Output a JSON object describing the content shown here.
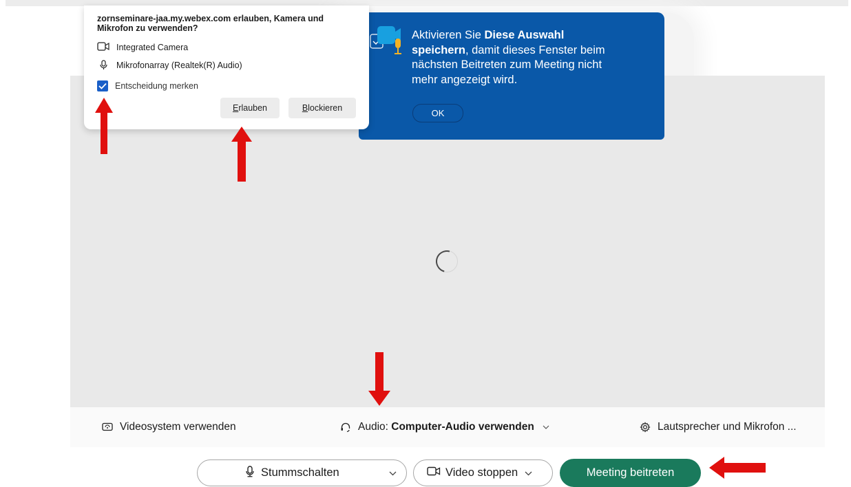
{
  "permission_dialog": {
    "title": "zornseminare-jaa.my.webex.com erlauben, Kamera und Mikrofon zu verwenden?",
    "camera": "Integrated Camera",
    "microphone": "Mikrofonarray (Realtek(R) Audio)",
    "remember": "Entscheidung merken",
    "remember_checked": true,
    "allow_first": "E",
    "allow_rest": "rlauben",
    "block_first": "B",
    "block_rest": "lockieren"
  },
  "tooltip": {
    "line_pre": "Aktivieren Sie ",
    "line_bold": "Diese Auswahl speichern",
    "line_post": ", damit dieses Fenster beim nächsten Beitreten zum Meeting nicht mehr angezeigt wird.",
    "ok": "OK"
  },
  "settings_bar": {
    "video_system": "Videosystem verwenden",
    "audio_label": "Audio:",
    "audio_value": "Computer-Audio verwenden",
    "speaker": "Lautsprecher und Mikrofon ..."
  },
  "controls": {
    "mute": "Stummschalten",
    "video": "Video stoppen",
    "join": "Meeting beitreten"
  },
  "colors": {
    "join": "#1a7a5c",
    "tooltip": "#0a58a8",
    "checkbox": "#1a5fc8",
    "arrow": "#e0100e"
  }
}
